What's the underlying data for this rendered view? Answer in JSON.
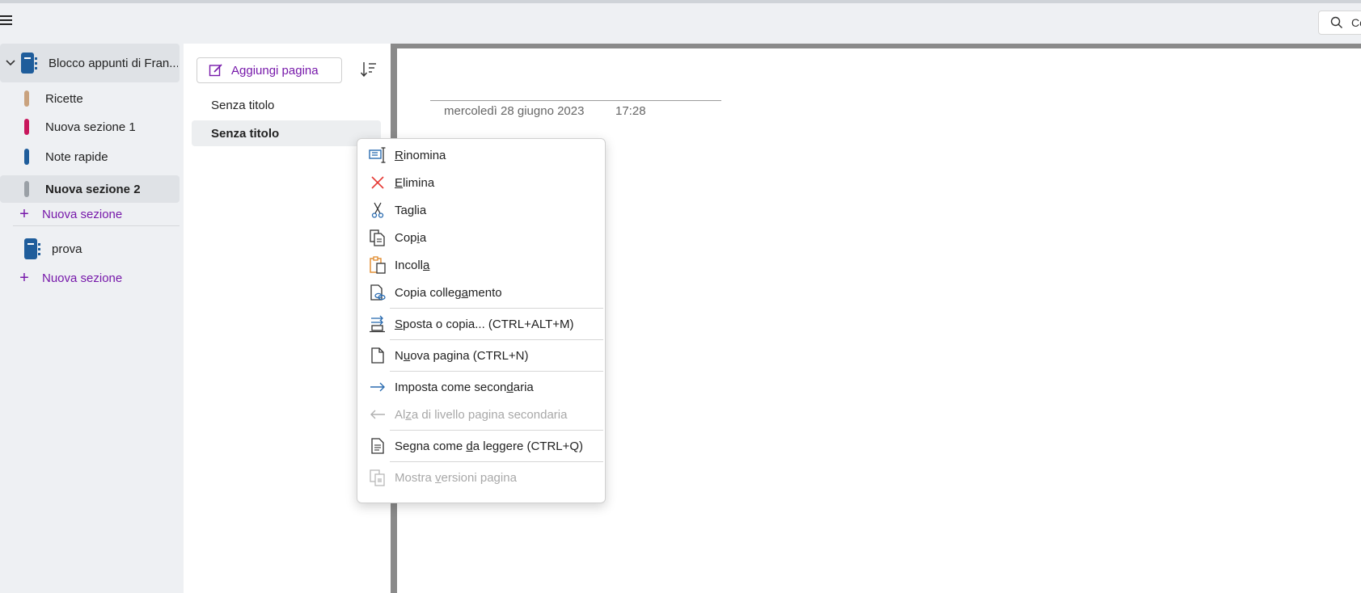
{
  "search": {
    "label": "Ce"
  },
  "sidebar": {
    "notebooks": [
      {
        "title": "Blocco appunti di Fran...",
        "sections": [
          {
            "label": "Ricette",
            "color": "#c9a27e"
          },
          {
            "label": "Nuova sezione 1",
            "color": "#c8175c"
          },
          {
            "label": "Note rapide",
            "color": "#1f5d9b"
          },
          {
            "label": "Nuova sezione 2",
            "color": "#9aa0a6"
          }
        ],
        "add_section": "Nuova sezione"
      },
      {
        "title": "prova",
        "sections": [],
        "add_section": "Nuova sezione"
      }
    ]
  },
  "pagelist": {
    "add_page": "Aggiungi pagina",
    "pages": [
      {
        "title": "Senza titolo"
      },
      {
        "title": "Senza titolo"
      }
    ]
  },
  "page": {
    "date": "mercoledì 28 giugno 2023",
    "time": "17:28"
  },
  "context_menu": {
    "items": [
      {
        "pre": "",
        "key": "R",
        "post": "inomina",
        "icon": "rename-icon",
        "enabled": true
      },
      {
        "pre": "",
        "key": "E",
        "post": "limina",
        "icon": "delete-icon",
        "enabled": true
      },
      {
        "pre": "Ta",
        "key": "g",
        "post": "lia",
        "icon": "scissors-icon",
        "enabled": true
      },
      {
        "pre": "Cop",
        "key": "i",
        "post": "a",
        "icon": "copy-icon",
        "enabled": true
      },
      {
        "pre": "Incoll",
        "key": "a",
        "post": "",
        "icon": "paste-icon",
        "enabled": true
      },
      {
        "pre": "Copia colleg",
        "key": "a",
        "post": "mento",
        "icon": "copy-link-icon",
        "enabled": true
      },
      {
        "pre": "",
        "key": "S",
        "post": "posta o copia...  (CTRL+ALT+M)",
        "icon": "move-copy-icon",
        "enabled": true
      },
      {
        "pre": "N",
        "key": "u",
        "post": "ova pagina  (CTRL+N)",
        "icon": "new-page-icon",
        "enabled": true
      },
      {
        "pre": "Imposta come secon",
        "key": "d",
        "post": "aria",
        "icon": "arrow-right-icon",
        "enabled": true
      },
      {
        "pre": "Al",
        "key": "z",
        "post": "a di livello pagina secondaria",
        "icon": "arrow-left-icon",
        "enabled": false
      },
      {
        "pre": "Segna come ",
        "key": "d",
        "post": "a leggere  (CTRL+Q)",
        "icon": "mark-unread-icon",
        "enabled": true
      },
      {
        "pre": "Mostra ",
        "key": "v",
        "post": "ersioni pagina",
        "icon": "page-versions-icon",
        "enabled": false
      }
    ]
  }
}
